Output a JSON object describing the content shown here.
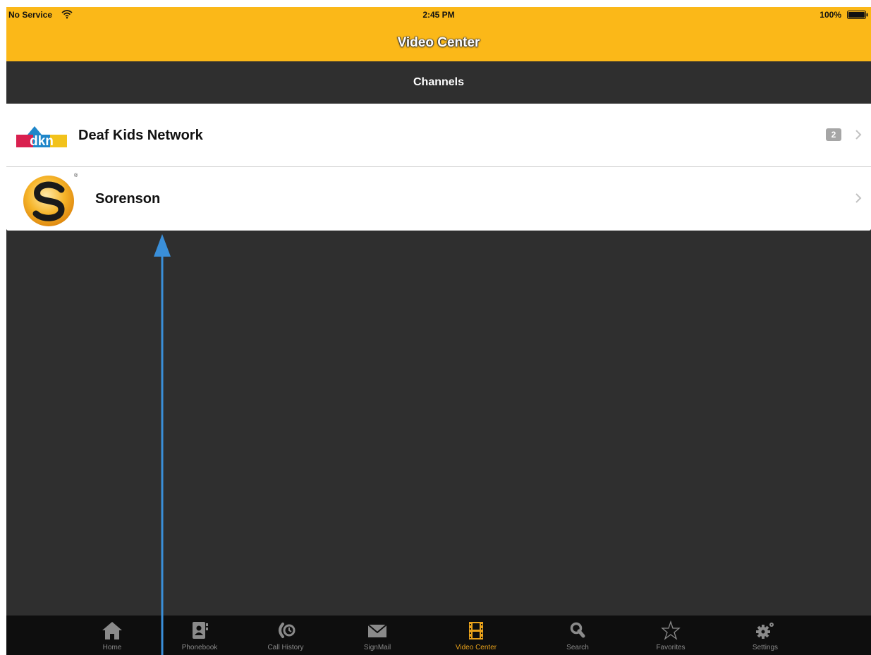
{
  "status_bar": {
    "carrier": "No Service",
    "time": "2:45 PM",
    "battery": "100%"
  },
  "nav": {
    "title": "Video Center"
  },
  "section": {
    "header": "Channels"
  },
  "channels": [
    {
      "name": "Deaf Kids Network",
      "badge": "2",
      "logo": "dkn-logo"
    },
    {
      "name": "Sorenson",
      "logo": "sorenson-logo"
    }
  ],
  "tabs": [
    {
      "label": "Home",
      "icon": "home-icon"
    },
    {
      "label": "Phonebook",
      "icon": "phonebook-icon"
    },
    {
      "label": "Call History",
      "icon": "call-history-icon"
    },
    {
      "label": "SignMail",
      "icon": "signmail-icon"
    },
    {
      "label": "Video Center",
      "icon": "video-center-icon",
      "active": true
    },
    {
      "label": "Search",
      "icon": "search-icon"
    },
    {
      "label": "Favorites",
      "icon": "star-icon"
    },
    {
      "label": "Settings",
      "icon": "settings-icon"
    }
  ],
  "colors": {
    "accent": "#fbb818",
    "content_bg": "#2f2f2f",
    "tab_active": "#e9a21b",
    "annotation": "#3a8fd9"
  }
}
